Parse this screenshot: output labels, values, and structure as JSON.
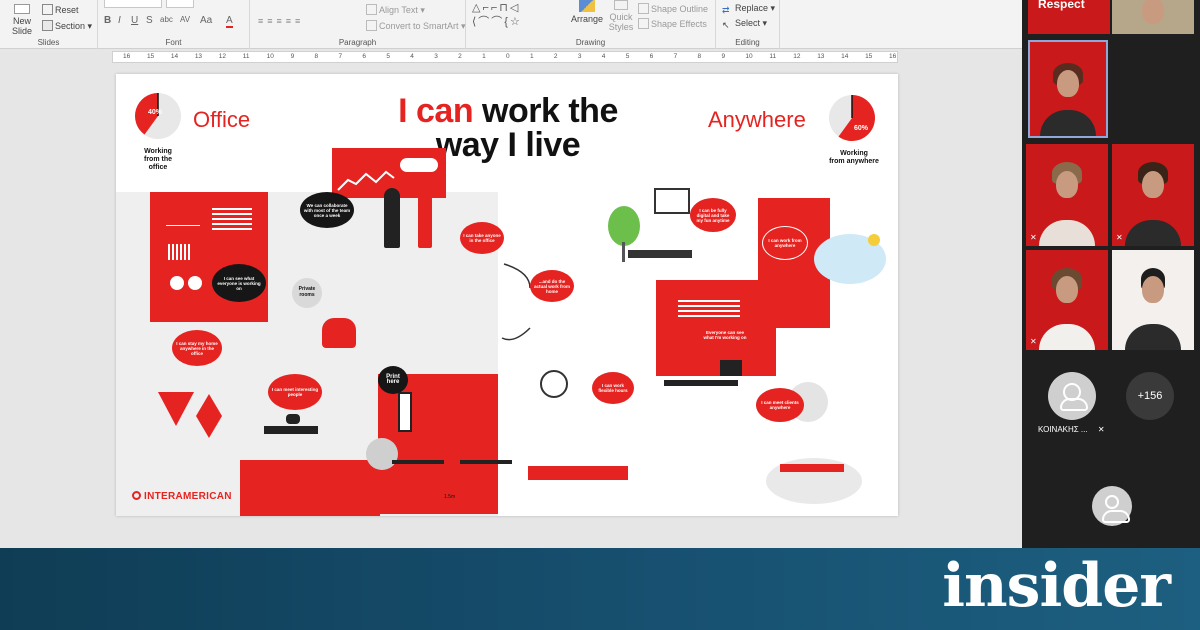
{
  "ribbon": {
    "slides_group": {
      "new_slide": "New",
      "new_slide_2": "Slide",
      "reset": "Reset",
      "section": "Section",
      "label": "Slides"
    },
    "font_group": {
      "label": "Font",
      "bold": "B",
      "italic": "I",
      "underline": "U",
      "strike": "S",
      "shadow": "abc",
      "spacing": "AV",
      "case": "Aa",
      "color": "A"
    },
    "paragraph_group": {
      "label": "Paragraph",
      "align_text": "Align Text",
      "smartart": "Convert to SmartArt"
    },
    "drawing_group": {
      "label": "Drawing",
      "arrange": "Arrange",
      "quick_styles": "Quick",
      "quick_styles_2": "Styles",
      "shape_outline": "Shape Outline",
      "shape_effects": "Shape Effects"
    },
    "editing_group": {
      "label": "Editing",
      "replace": "Replace",
      "select": "Select"
    }
  },
  "ruler": [
    "16",
    "15",
    "14",
    "13",
    "12",
    "11",
    "10",
    "9",
    "8",
    "7",
    "6",
    "5",
    "4",
    "3",
    "2",
    "1",
    "0",
    "1",
    "2",
    "3",
    "4",
    "5",
    "6",
    "7",
    "8",
    "9",
    "10",
    "11",
    "12",
    "13",
    "14",
    "15",
    "16"
  ],
  "slide": {
    "title_red": "I can",
    "title_rest": " work the",
    "title_line2": "way I live",
    "office_label": "Office",
    "anywhere_label": "Anywhere",
    "office_pct": "40%",
    "anywhere_pct": "60%",
    "office_pct_value": 40,
    "anywhere_pct_value": 60,
    "working_office": [
      "Working",
      "from the",
      "office"
    ],
    "working_anywhere": [
      "Working",
      "from anywhere"
    ],
    "private_rooms": [
      "Private",
      "rooms"
    ],
    "print_here": "Print here",
    "bubbles": {
      "collaborate": "We can collaborate with most of the team once a week",
      "see_working": "I can see what everyone is working on",
      "take_anyone": "I can take anyone in the office",
      "stay_home": "I can stay my home anywhere in the office",
      "meet_people": "I can meet interesting people",
      "do_actual": "...and do the actual work from home",
      "fully_digital": "I can be fully digital and take my fun anytime",
      "work_anywhere": "I can work from anywhere",
      "see_working2": "Everyone can see what I'm working on",
      "flexible": "I can work flexible hours",
      "meet_clients": "I can meet clients anywhere"
    },
    "distance": "1.5m",
    "logo": "INTERAMERICAN",
    "accent_color": "#e52421"
  },
  "meeting_panel": {
    "respect_label": "Respect",
    "participant_name": "ΚΟΙΝΑΚΗΣ ...",
    "overflow_count": "+156"
  },
  "banner": {
    "brand": "insider"
  }
}
